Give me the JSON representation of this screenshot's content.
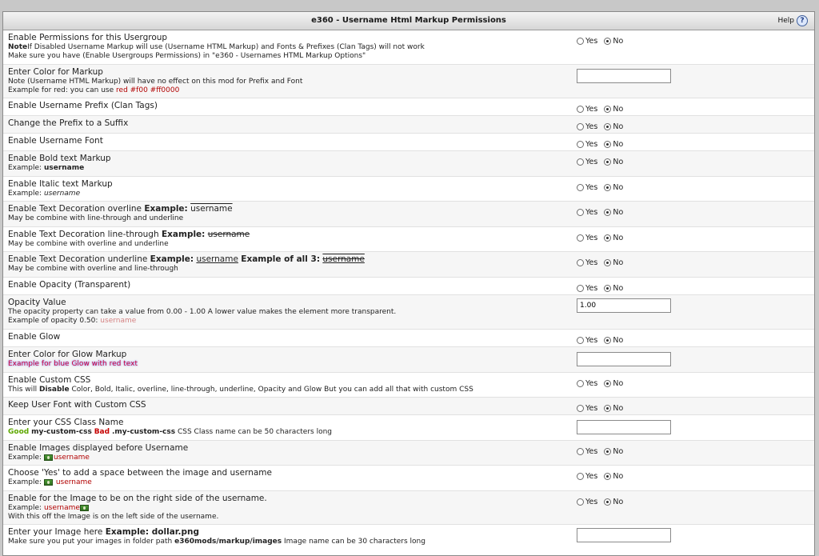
{
  "header": {
    "title": "e360 - Username Html Markup Permissions",
    "help_label": "Help",
    "help_icon": "?"
  },
  "labels": {
    "yes": "Yes",
    "no": "No"
  },
  "rows": [
    {
      "title": "Enable Permissions for this Usergroup",
      "note_bold": "Note",
      "note_rest": "If Disabled Username Markup will use (Username HTML Markup) and Fonts & Prefixes (Clan Tags) will not work",
      "note2": "Make sure you have (Enable Usergroups Permissions) in \"e360 - Usernames HTML Markup Options\""
    },
    {
      "title": "Enter Color for Markup",
      "note": "Note (Username HTML Markup) will have no effect on this mod for Prefix and Font",
      "ex_prefix": "Example for red: you can use",
      "ex_value": "red #f00 #ff0000",
      "value": ""
    },
    {
      "title": "Enable Username Prefix (Clan Tags)"
    },
    {
      "title": "Change the Prefix to a Suffix"
    },
    {
      "title": "Enable Username Font"
    },
    {
      "title": "Enable Bold text Markup",
      "ex_label": "Example:",
      "ex_value": "username"
    },
    {
      "title": "Enable Italic text Markup",
      "ex_label": "Example:",
      "ex_value": "username"
    },
    {
      "title": "Enable Text Decoration overline",
      "ex_label": "Example:",
      "ex_value": "username",
      "note": "May be combine with line-through and underline"
    },
    {
      "title": "Enable Text Decoration line-through",
      "ex_label": "Example:",
      "ex_value": "username",
      "note": "May be combine with overline and underline"
    },
    {
      "title": "Enable Text Decoration underline",
      "ex_label": "Example:",
      "ex_value": "username",
      "ex2_label": "Example of all 3:",
      "ex2_value": "username",
      "note": "May be combine with overline and line-through"
    },
    {
      "title": "Enable Opacity (Transparent)"
    },
    {
      "title": "Opacity Value",
      "note": "The opacity property can take a value from 0.00 - 1.00 A lower value makes the element more transparent.",
      "ex_label": "Example of opacity 0.50:",
      "ex_value": "username",
      "value": "1.00"
    },
    {
      "title": "Enable Glow"
    },
    {
      "title": "Enter Color for Glow Markup",
      "note": "Example for blue Glow with red text",
      "value": ""
    },
    {
      "title": "Enable Custom CSS",
      "note_pre": "This will",
      "note_bold": "Disable",
      "note_rest": "Color, Bold, Italic, overline, line-through, underline, Opacity and Glow But you can add all that with custom CSS"
    },
    {
      "title": "Keep User Font with Custom CSS"
    },
    {
      "title": "Enter your CSS Class Name",
      "good": "Good",
      "good_value": "my-custom-css",
      "bad": "Bad",
      "bad_value": ".my-custom-css",
      "note_rest": "CSS Class name can be 50 characters long",
      "value": ""
    },
    {
      "title": "Enable Images displayed before Username",
      "ex_label": "Example:",
      "ex_value": "username"
    },
    {
      "title": "Choose 'Yes' to add a space between the image and username",
      "ex_label": "Example:",
      "ex_value": "username"
    },
    {
      "title": "Enable for the Image to be on the right side of the username.",
      "ex_label": "Example:",
      "ex_value": "username",
      "note": "With this off the Image is on the left side of the username."
    },
    {
      "title": "Enter your Image here",
      "ex_label": "Example: dollar.png",
      "note_pre": "Make sure you put your images in folder path",
      "note_bold": "e360mods/markup/images",
      "note_rest": "Image name can be 30 characters long",
      "value": ""
    }
  ]
}
